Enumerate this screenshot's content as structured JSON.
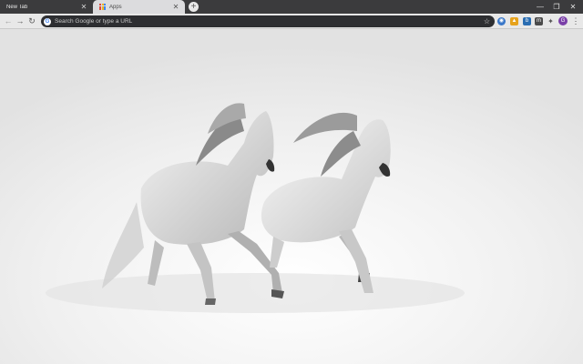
{
  "tabs": [
    {
      "title": "New Tab",
      "active": false
    },
    {
      "title": "Apps",
      "active": true
    }
  ],
  "omnibox": {
    "placeholder": "Search Google or type a URL"
  },
  "colors": {
    "tabstrip": "#3b3b3d",
    "active_tab": "#dcdcde",
    "toolbar": "#e8e8e8",
    "omnibox": "#2d2e31",
    "background": "#f2f2f2"
  },
  "extensions": [
    "extension-blue-icon",
    "extension-shield-icon",
    "extension-b-icon",
    "extension-m-icon",
    "puzzle-icon",
    "media-queue-icon"
  ],
  "background_image": "two white horses running through snow"
}
